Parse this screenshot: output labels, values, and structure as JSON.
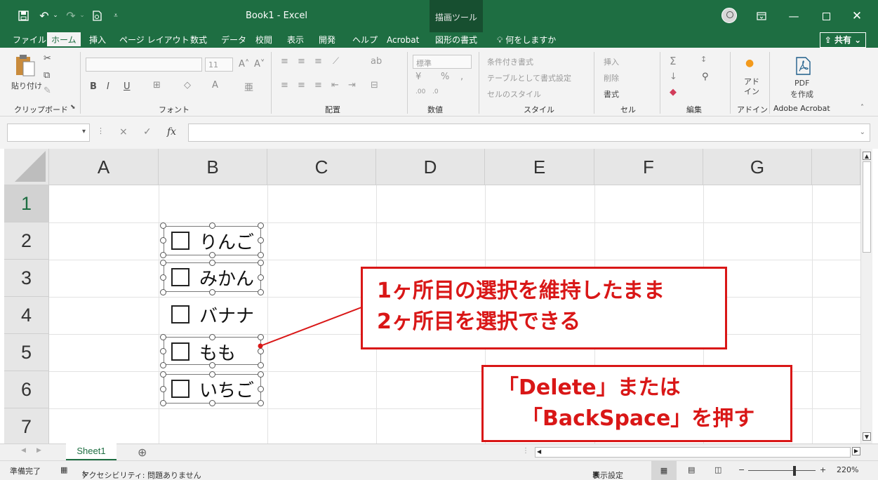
{
  "title_bar": {
    "document_title": "Book1  -  Excel",
    "contextual_tab": "描画ツール",
    "qa_icons": [
      "save-icon",
      "undo-icon",
      "redo-icon",
      "print-preview-icon",
      "customize-qat-icon"
    ],
    "window_icons": [
      "ribbon-display-icon",
      "minimize-icon",
      "maximize-icon",
      "close-icon"
    ]
  },
  "tabs": [
    {
      "label": "ファイル",
      "active": false
    },
    {
      "label": "ホーム",
      "active": true
    },
    {
      "label": "挿入",
      "active": false
    },
    {
      "label": "ページ レイアウト",
      "active": false
    },
    {
      "label": "数式",
      "active": false
    },
    {
      "label": "データ",
      "active": false
    },
    {
      "label": "校閲",
      "active": false
    },
    {
      "label": "表示",
      "active": false
    },
    {
      "label": "開発",
      "active": false
    },
    {
      "label": "ヘルプ",
      "active": false
    },
    {
      "label": "Acrobat",
      "active": false
    },
    {
      "label": "図形の書式",
      "active": false
    }
  ],
  "tell_me": "何をしますか",
  "share_label": "共有",
  "ribbon": {
    "clipboard": {
      "paste": "貼り付け",
      "group": "クリップボード"
    },
    "font": {
      "size": "11",
      "group": "フォント",
      "bold": "B",
      "italic": "I",
      "underline": "U"
    },
    "alignment": {
      "group": "配置"
    },
    "number": {
      "format": "標準",
      "group": "数値",
      "percent": "%",
      "comma": ","
    },
    "styles": {
      "conditional": "条件付き書式",
      "table": "テーブルとして書式設定",
      "cell_styles": "セルのスタイル",
      "group": "スタイル"
    },
    "cells": {
      "insert": "挿入",
      "delete": "削除",
      "format": "書式",
      "group": "セル"
    },
    "editing": {
      "group": "編集"
    },
    "addins": {
      "label": "アドイン",
      "short": "アド\nイン",
      "group": "アドイン"
    },
    "acrobat": {
      "pdf": "PDF",
      "create": "を作成",
      "group": "Adobe Acrobat"
    }
  },
  "formula_bar": {
    "name_box": "",
    "fx": "fx",
    "cancel": "×",
    "enter": "✓",
    "formula": ""
  },
  "columns": [
    "A",
    "B",
    "C",
    "D",
    "E",
    "F",
    "G"
  ],
  "rows": [
    "1",
    "2",
    "3",
    "4",
    "5",
    "6",
    "7"
  ],
  "checkboxes": [
    {
      "label": "りんご",
      "row": "2",
      "selected": true
    },
    {
      "label": "みかん",
      "row": "3",
      "selected": true
    },
    {
      "label": "バナナ",
      "row": "4",
      "selected": false
    },
    {
      "label": "もも",
      "row": "5",
      "selected": true
    },
    {
      "label": "いちご",
      "row": "6",
      "selected": true
    }
  ],
  "callouts": {
    "first": {
      "line1": "1ヶ所目の選択を維持したまま",
      "line2": "2ヶ所目を選択できる"
    },
    "second": {
      "line1": "「Delete」または",
      "line2": "「BackSpace」を押す"
    }
  },
  "sheets": {
    "active": "Sheet1",
    "add": "⊕"
  },
  "status_bar": {
    "ready": "準備完了",
    "accessibility": "アクセシビリティ: 問題ありません",
    "display_settings": "表示設定",
    "zoom": "220%",
    "zoom_minus": "−",
    "zoom_plus": "+"
  },
  "colors": {
    "accent": "#1e6e42",
    "callout": "#d91717"
  }
}
